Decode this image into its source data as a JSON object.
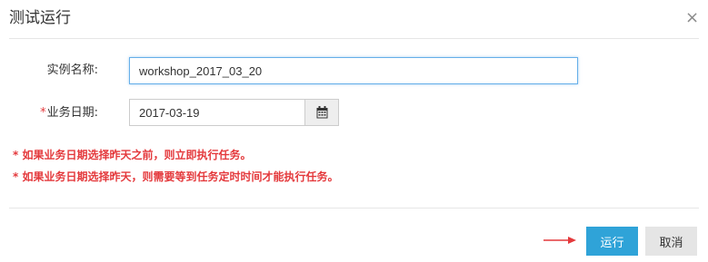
{
  "dialog": {
    "title": "测试运行",
    "close_glyph": "×"
  },
  "form": {
    "instance_name": {
      "label": "实例名称:",
      "value": "workshop_2017_03_20"
    },
    "business_date": {
      "required_mark": "*",
      "label": "业务日期:",
      "value": "2017-03-19",
      "picker_icon": "calendar-icon"
    }
  },
  "notes": [
    "* 如果业务日期选择昨天之前，则立即执行任务。",
    "* 如果业务日期选择昨天，则需要等到任务定时时间才能执行任务。"
  ],
  "footer": {
    "run_label": "运行",
    "cancel_label": "取消",
    "pointer_icon": "red-arrow-icon"
  },
  "colors": {
    "primary": "#2fa3d8",
    "warning": "#e4393c",
    "focus_border": "#66afe9"
  }
}
